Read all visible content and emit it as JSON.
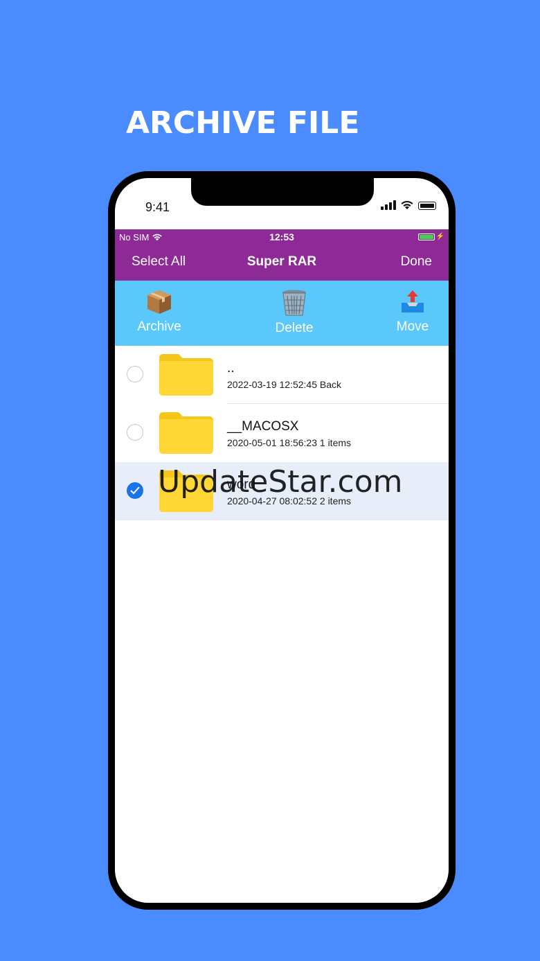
{
  "headline": "ARCHIVE FILE",
  "device": {
    "time": "9:41"
  },
  "app_status": {
    "carrier": "No SIM",
    "clock": "12:53",
    "battery_color": "#3cd64a"
  },
  "navbar": {
    "left": "Select All",
    "title": "Super RAR",
    "right": "Done",
    "color": "#8e2a96"
  },
  "toolbar": {
    "color": "#5ac8fa",
    "archive": {
      "label": "Archive",
      "icon": "package-icon"
    },
    "delete": {
      "label": "Delete",
      "icon": "trash-icon"
    },
    "move": {
      "label": "Move",
      "icon": "inbox-upload-icon"
    }
  },
  "files": [
    {
      "name": "..",
      "meta": "2022-03-19 12:52:45 Back",
      "selected": false
    },
    {
      "name": "__MACOSX",
      "meta": "2020-05-01 18:56:23 1 items",
      "selected": false
    },
    {
      "name": "word",
      "meta": "2020-04-27 08:02:52 2 items",
      "selected": true
    }
  ],
  "watermark": "UpdateStar.com"
}
